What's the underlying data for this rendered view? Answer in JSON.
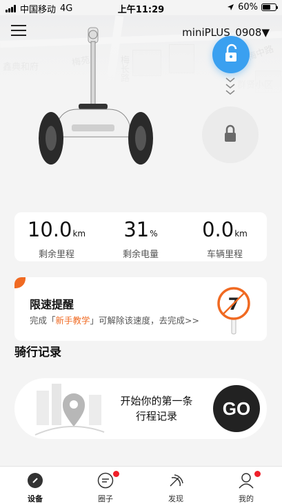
{
  "status_bar": {
    "carrier": "中国移动",
    "network": "4G",
    "time": "上午11:29",
    "battery": "60%",
    "battery_level": 0.6
  },
  "header": {
    "device_name": "miniPLUS_0908▼"
  },
  "map": {
    "labels": [
      "鑫典和府",
      "梅苑",
      "梅长路",
      "梅中路",
      "群贤小区"
    ]
  },
  "stats": [
    {
      "value": "10.0",
      "unit": "km",
      "label": "剩余里程"
    },
    {
      "value": "31",
      "unit": "%",
      "label": "剩余电量"
    },
    {
      "value": "0.0",
      "unit": "km",
      "label": "车辆里程"
    }
  ],
  "speed_limit": {
    "title": "限速提醒",
    "desc_pre": "完成「",
    "desc_link": "新手教学",
    "desc_post": "」可解除该速度，去完成>>",
    "sign_value": "7",
    "accent": "#f06a22"
  },
  "rides": {
    "section_title": "骑行记录",
    "prompt_line1": "开始你的第一条",
    "prompt_line2": "行程记录",
    "go_label": "GO"
  },
  "tabs": [
    {
      "label": "设备",
      "icon": "device-icon",
      "active": true,
      "badge": false
    },
    {
      "label": "圈子",
      "icon": "circle-chat-icon",
      "active": false,
      "badge": true
    },
    {
      "label": "发现",
      "icon": "discover-icon",
      "active": false,
      "badge": false
    },
    {
      "label": "我的",
      "icon": "profile-icon",
      "active": false,
      "badge": true
    }
  ],
  "colors": {
    "primary_blue": "#3aa0f0",
    "badge_red": "#f0202a"
  }
}
